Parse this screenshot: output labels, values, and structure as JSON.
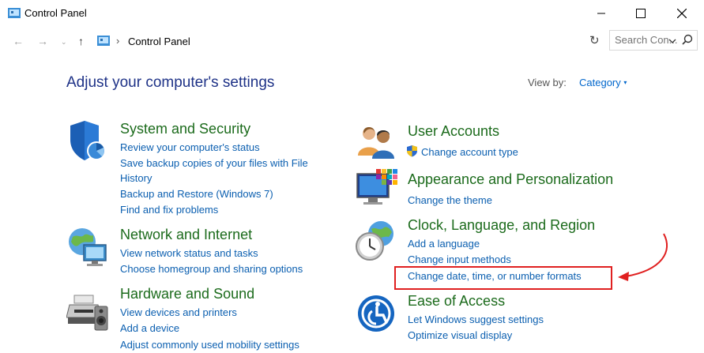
{
  "window": {
    "title": "Control Panel"
  },
  "address": {
    "crumb": "Control Panel",
    "search_placeholder": "Search Con..."
  },
  "main": {
    "heading": "Adjust your computer's settings",
    "view_by_label": "View by:",
    "view_by_value": "Category"
  },
  "categories": {
    "system": {
      "title": "System and Security",
      "links": [
        "Review your computer's status",
        "Save backup copies of your files with File",
        "History",
        "Backup and Restore (Windows 7)",
        "Find and fix problems"
      ]
    },
    "network": {
      "title": "Network and Internet",
      "links": [
        "View network status and tasks",
        "Choose homegroup and sharing options"
      ]
    },
    "hardware": {
      "title": "Hardware and Sound",
      "links": [
        "View devices and printers",
        "Add a device",
        "Adjust commonly used mobility settings"
      ]
    },
    "users": {
      "title": "User Accounts",
      "links": [
        "Change account type"
      ]
    },
    "appearance": {
      "title": "Appearance and Personalization",
      "links": [
        "Change the theme"
      ]
    },
    "clock": {
      "title": "Clock, Language, and Region",
      "links": [
        "Add a language",
        "Change input methods",
        "Change date, time, or number formats"
      ]
    },
    "ease": {
      "title": "Ease of Access",
      "links": [
        "Let Windows suggest settings",
        "Optimize visual display"
      ]
    }
  },
  "colors": {
    "category": "#1c6b1c",
    "link": "#0b5fb0",
    "heading": "#1e3287",
    "annotation": "#e02020"
  }
}
